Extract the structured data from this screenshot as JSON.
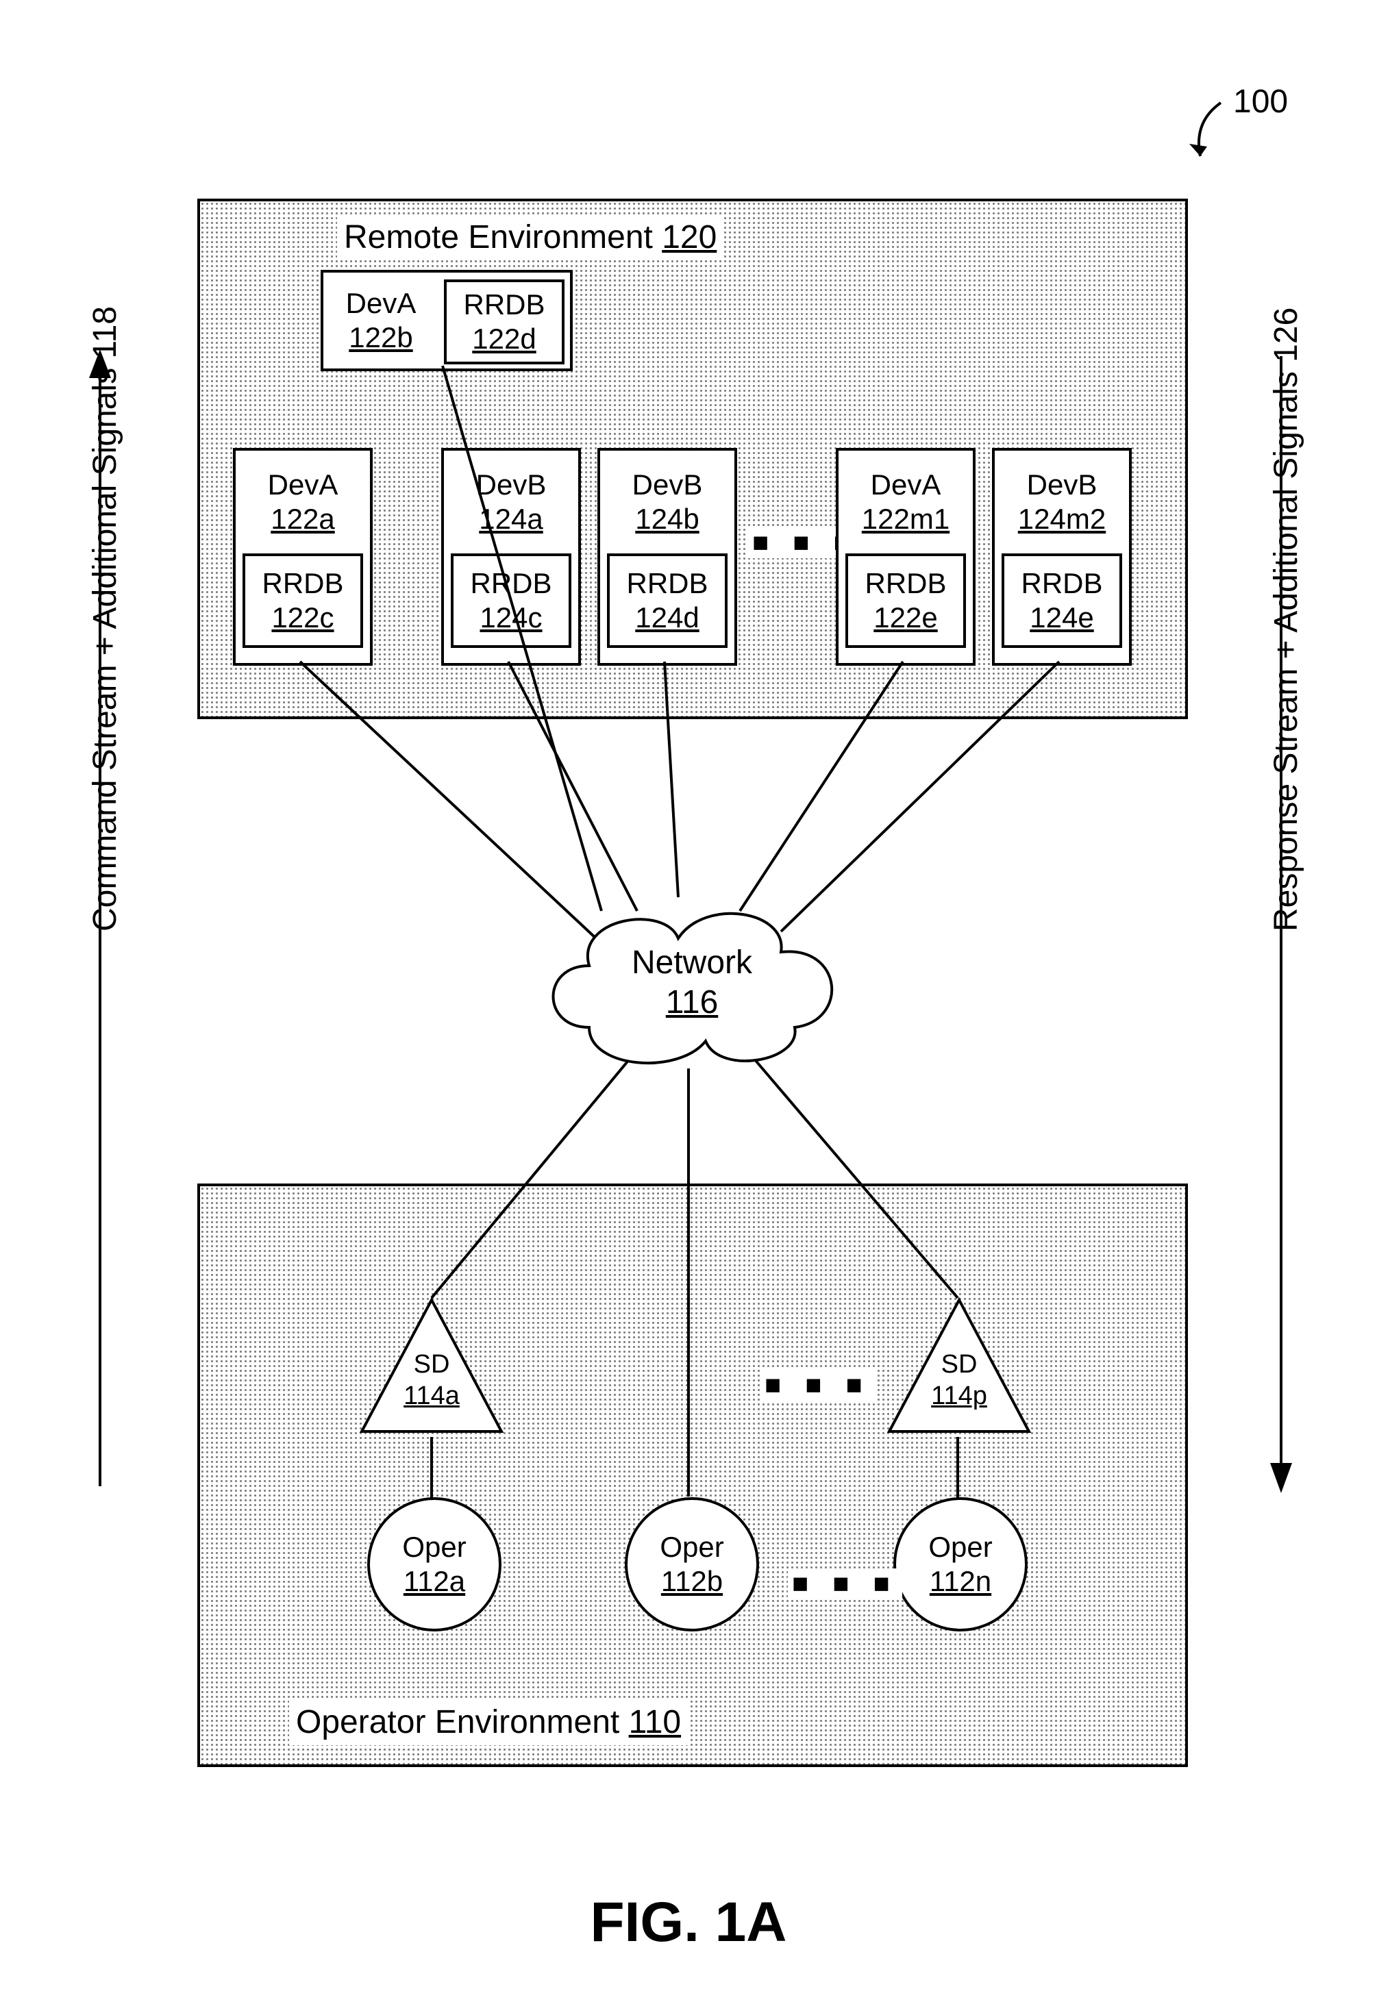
{
  "figure": {
    "title": "FIG. 1A",
    "ref": "100"
  },
  "left_arrow_label": "Command Stream + Additional Signals 118",
  "right_arrow_label": "Response Stream + Additional Signals 126",
  "remote_env": {
    "title_prefix": "Remote Environment ",
    "title_ref": "120",
    "dev_top": {
      "name": "DevA",
      "ref": "122b",
      "rrdb_name": "RRDB",
      "rrdb_ref": "122d"
    },
    "row": [
      {
        "name": "DevA",
        "ref": "122a",
        "rrdb_name": "RRDB",
        "rrdb_ref": "122c"
      },
      {
        "name": "DevB",
        "ref": "124a",
        "rrdb_name": "RRDB",
        "rrdb_ref": "124c"
      },
      {
        "name": "DevB",
        "ref": "124b",
        "rrdb_name": "RRDB",
        "rrdb_ref": "124d"
      },
      {
        "name": "DevA",
        "ref": "122m1",
        "rrdb_name": "RRDB",
        "rrdb_ref": "122e"
      },
      {
        "name": "DevB",
        "ref": "124m2",
        "rrdb_name": "RRDB",
        "rrdb_ref": "124e"
      }
    ]
  },
  "network": {
    "name": "Network",
    "ref": "116"
  },
  "operator_env": {
    "title_prefix": "Operator Environment ",
    "title_ref": "110",
    "sd": [
      {
        "name": "SD",
        "ref": "114a"
      },
      {
        "name": "SD",
        "ref": "114p"
      }
    ],
    "oper": [
      {
        "name": "Oper",
        "ref": "112a"
      },
      {
        "name": "Oper",
        "ref": "112b"
      },
      {
        "name": "Oper",
        "ref": "112n"
      }
    ]
  },
  "ellipsis": "■ ■ ■"
}
